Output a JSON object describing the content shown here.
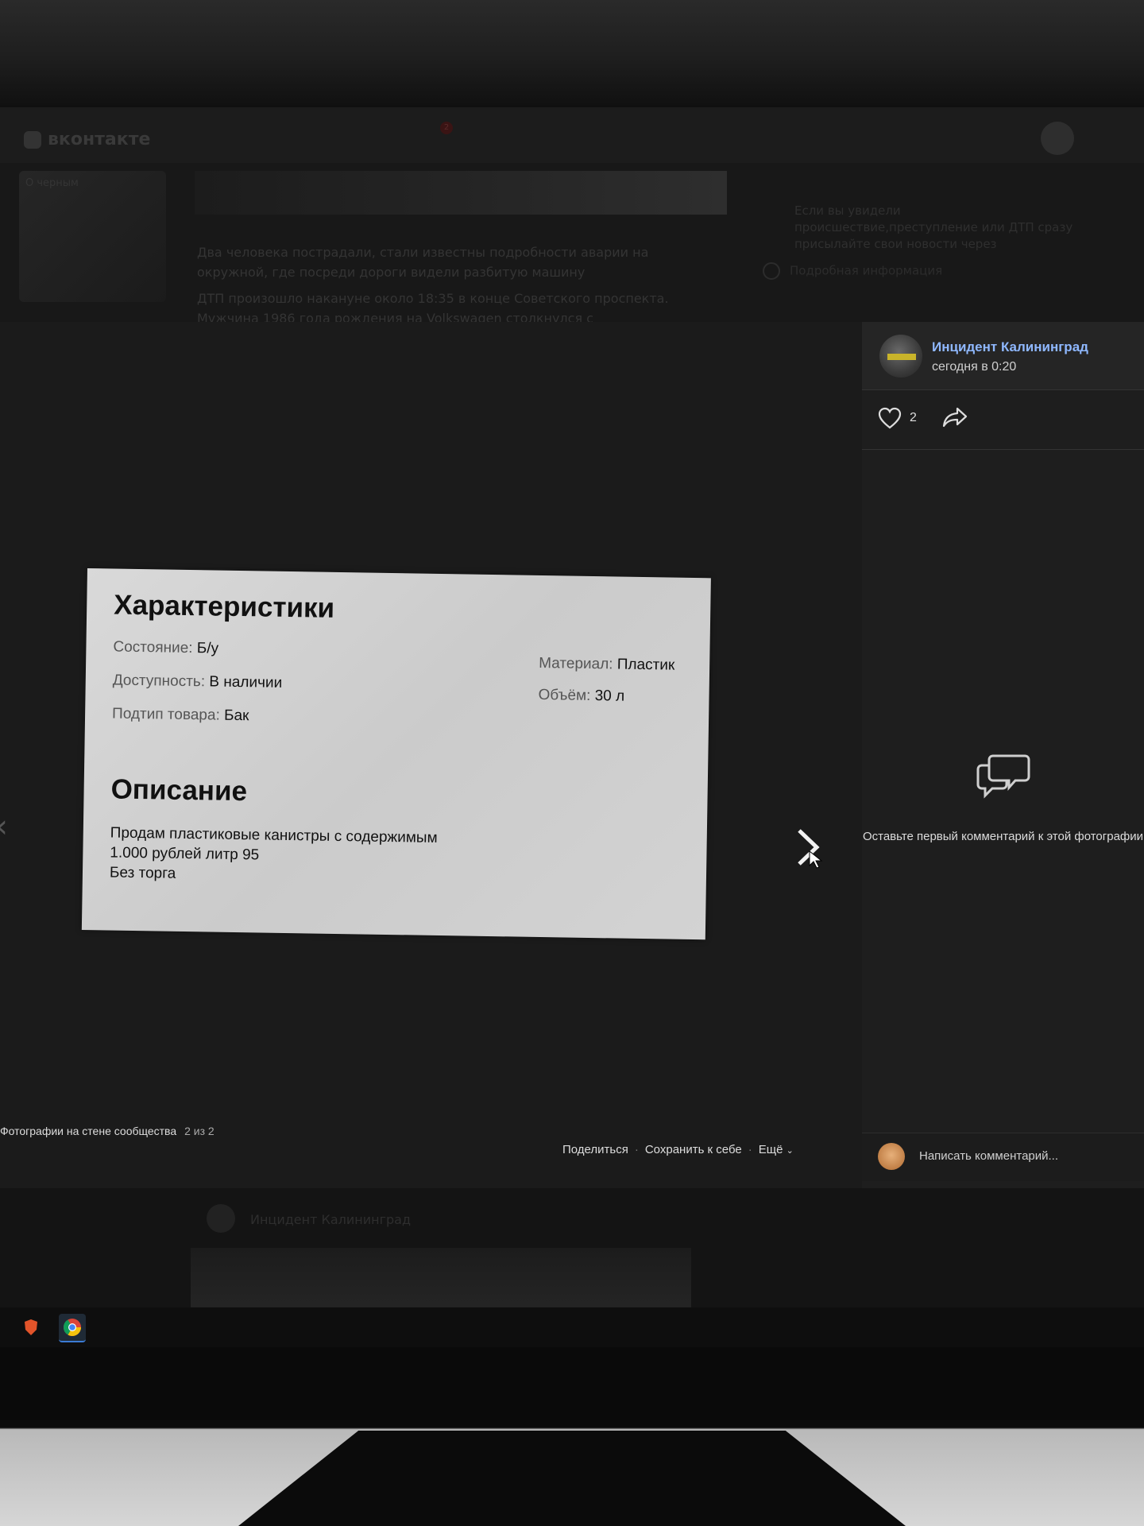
{
  "background_page": {
    "logo": "вконтакте",
    "notification_count": "2",
    "thumb_label": "О черным",
    "feed_lines": [
      "Два человека пострадали, стали известны подробности аварии на",
      "окружной, где посреди дороги видели разбитую машину",
      "ДТП произошло накануне около 18:35 в конце Советского проспекта.",
      "Мужчина 1986 года рождения на Volkswagen столкнулся с"
    ],
    "side_text": "Если вы увидели происшествие,преступление или ДТП сразу присылайте свои новости через",
    "info_link": "Подробная информация",
    "below_name": "Инцидент Калининград"
  },
  "photo": {
    "specs_title": "Характеристики",
    "specs_left": [
      {
        "key": "Состояние:",
        "value": "Б/у"
      },
      {
        "key": "Доступность:",
        "value": "В наличии"
      },
      {
        "key": "Подтип товара:",
        "value": "Бак"
      }
    ],
    "specs_right": [
      {
        "key": "Материал:",
        "value": "Пластик"
      },
      {
        "key": "Объём:",
        "value": "30 л"
      }
    ],
    "desc_title": "Описание",
    "desc_text": "Продам пластиковые канистры с содержимым\n1.000 рублей литр 95\nБез торга"
  },
  "viewer": {
    "album_label": "Фотографии на стене сообщества",
    "counter": "2 из 2",
    "share_label": "Поделиться",
    "save_label": "Сохранить к себе",
    "more_label": "Ещё",
    "prev_icon": "chevron-left-icon",
    "next_icon": "chevron-right-icon"
  },
  "post": {
    "author": "Инцидент Калининград",
    "time": "сегодня в 0:20",
    "likes": "2"
  },
  "comments": {
    "empty_text": "Оставьте первый комментарий к этой фотографии",
    "input_placeholder": "Написать комментарий..."
  },
  "colors": {
    "link": "#8fb8ff",
    "viewer_bg": "#1a1a1a",
    "panel_bg": "#1e1e1e"
  }
}
